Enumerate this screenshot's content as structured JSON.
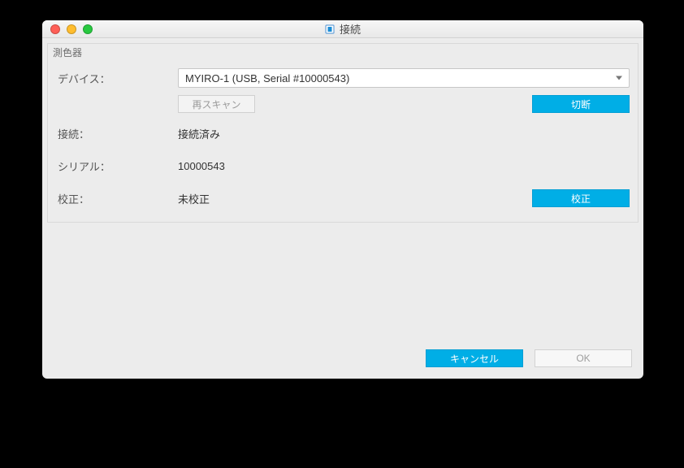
{
  "window": {
    "title": "接続"
  },
  "group": {
    "title": "測色器"
  },
  "labels": {
    "device": "デバイス：",
    "connection": "接続：",
    "serial": "シリアル：",
    "calibration": "校正："
  },
  "device": {
    "selected": "MYIRO-1 (USB, Serial #10000543)"
  },
  "values": {
    "connection": "接続済み",
    "serial": "10000543",
    "calibration": "未校正"
  },
  "buttons": {
    "rescan": "再スキャン",
    "disconnect": "切断",
    "calibrate": "校正",
    "cancel": "キャンセル",
    "ok": "OK"
  }
}
